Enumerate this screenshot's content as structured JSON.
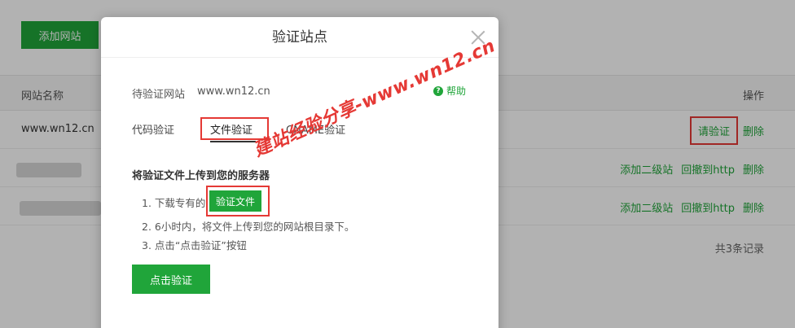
{
  "background": {
    "add_site_button": "添加网站",
    "table": {
      "col_name": "网站名称",
      "col_ops": "操作",
      "rows": [
        {
          "name": "www.wn12.cn",
          "ops": [
            "请验证",
            "删除"
          ]
        },
        {
          "name": "",
          "ops": [
            "添加二级站",
            "回撤到http",
            "删除"
          ]
        },
        {
          "name": "",
          "ops": [
            "添加二级站",
            "回撤到http",
            "删除"
          ]
        }
      ],
      "record_count": "共3条记录"
    }
  },
  "modal": {
    "title": "验证站点",
    "pending_label": "待验证网站",
    "pending_domain": "www.wn12.cn",
    "help_label": "帮助",
    "help_icon_glyph": "?",
    "tabs": [
      "代码验证",
      "文件验证",
      "CNAME验证"
    ],
    "section_title": "将验证文件上传到您的服务器",
    "step1_text": "1. 下载专有的",
    "download_button": "验证文件",
    "step2_text": "2. 6小时内，将文件上传到您的网站根目录下。",
    "step3_text": "3. 点击“点击验证”按钮",
    "verify_button": "点击验证"
  },
  "watermark": "建站经验分享-www.wn12.cn",
  "colors": {
    "accent": "#20a53a",
    "highlight": "#e53935"
  }
}
